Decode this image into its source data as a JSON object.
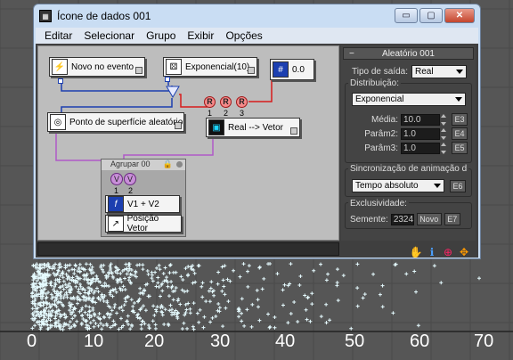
{
  "window": {
    "title": "Ícone de dados 001",
    "buttons": {
      "minimize": "▭",
      "maximize": "▢",
      "close": "✕"
    }
  },
  "menu": [
    "Editar",
    "Selecionar",
    "Grupo",
    "Exibir",
    "Opções"
  ],
  "nodes": {
    "novo_evento": "Novo no evento",
    "exponencial": "Exponencial(10)",
    "value_node": "0.0",
    "ponto": "Ponto de superfície aleatório",
    "real_vetor": "Real --> Vetor",
    "group_title": "Agrupar 00",
    "v1v2": "V1 + V2",
    "posicao": "Posição Vetor"
  },
  "ports": {
    "r": "R",
    "v": "V",
    "n1": "1",
    "n2": "2",
    "n3": "3"
  },
  "panel": {
    "rollout_title": "Aleatório 001",
    "output_type_label": "Tipo de saída:",
    "output_type_value": "Real",
    "distribution_label": "Distribuição:",
    "distribution_value": "Exponencial",
    "media_label": "Média:",
    "media_value": "10.0",
    "media_btn": "E3",
    "param2_label": "Parâm2:",
    "param2_value": "1.0",
    "param2_btn": "E4",
    "param3_label": "Parâm3:",
    "param3_value": "1.0",
    "param3_btn": "E5",
    "sync_label": "Sincronização de animação d",
    "sync_value": "Tempo absoluto",
    "sync_btn": "E6",
    "exclusivity_label": "Exclusividade:",
    "seed_label": "Semente:",
    "seed_value": "2324",
    "new_btn": "Novo",
    "new_btn_e": "E7"
  },
  "viewport": {
    "axis_labels": [
      "0",
      "10",
      "20",
      "30",
      "40",
      "50",
      "60",
      "70"
    ]
  },
  "colors": {
    "wire_blue": "#1c3fb0",
    "wire_red": "#d81c1c",
    "wire_purple": "#b05ac8",
    "particle": "#e6fbff"
  }
}
